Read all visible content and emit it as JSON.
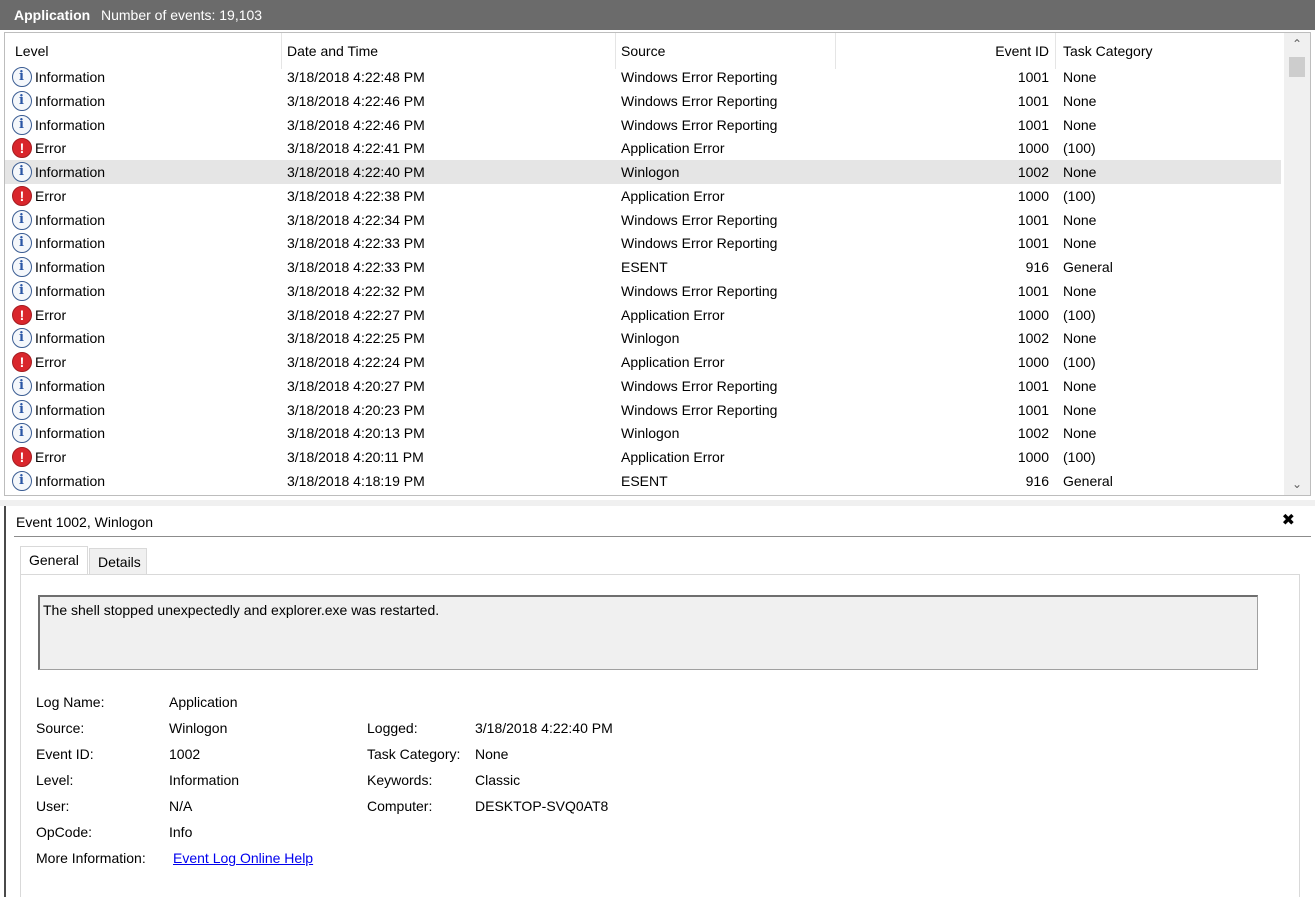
{
  "titlebar": {
    "log_name": "Application",
    "event_count": "Number of events: 19,103"
  },
  "grid": {
    "columns": [
      "Level",
      "Date and Time",
      "Source",
      "Event ID",
      "Task Category"
    ],
    "rows": [
      {
        "level": "Information",
        "icon": "info-icon",
        "date": "3/18/2018 4:22:48 PM",
        "source": "Windows Error Reporting",
        "event_id": "1001",
        "category": "None"
      },
      {
        "level": "Information",
        "icon": "info-icon",
        "date": "3/18/2018 4:22:46 PM",
        "source": "Windows Error Reporting",
        "event_id": "1001",
        "category": "None"
      },
      {
        "level": "Information",
        "icon": "info-icon",
        "date": "3/18/2018 4:22:46 PM",
        "source": "Windows Error Reporting",
        "event_id": "1001",
        "category": "None"
      },
      {
        "level": "Error",
        "icon": "error-icon",
        "date": "3/18/2018 4:22:41 PM",
        "source": "Application Error",
        "event_id": "1000",
        "category": "(100)"
      },
      {
        "level": "Information",
        "icon": "info-icon",
        "date": "3/18/2018 4:22:40 PM",
        "source": "Winlogon",
        "event_id": "1002",
        "category": "None",
        "selected": true
      },
      {
        "level": "Error",
        "icon": "error-icon",
        "date": "3/18/2018 4:22:38 PM",
        "source": "Application Error",
        "event_id": "1000",
        "category": "(100)"
      },
      {
        "level": "Information",
        "icon": "info-icon",
        "date": "3/18/2018 4:22:34 PM",
        "source": "Windows Error Reporting",
        "event_id": "1001",
        "category": "None"
      },
      {
        "level": "Information",
        "icon": "info-icon",
        "date": "3/18/2018 4:22:33 PM",
        "source": "Windows Error Reporting",
        "event_id": "1001",
        "category": "None"
      },
      {
        "level": "Information",
        "icon": "info-icon",
        "date": "3/18/2018 4:22:33 PM",
        "source": "ESENT",
        "event_id": "916",
        "category": "General"
      },
      {
        "level": "Information",
        "icon": "info-icon",
        "date": "3/18/2018 4:22:32 PM",
        "source": "Windows Error Reporting",
        "event_id": "1001",
        "category": "None"
      },
      {
        "level": "Error",
        "icon": "error-icon",
        "date": "3/18/2018 4:22:27 PM",
        "source": "Application Error",
        "event_id": "1000",
        "category": "(100)"
      },
      {
        "level": "Information",
        "icon": "info-icon",
        "date": "3/18/2018 4:22:25 PM",
        "source": "Winlogon",
        "event_id": "1002",
        "category": "None"
      },
      {
        "level": "Error",
        "icon": "error-icon",
        "date": "3/18/2018 4:22:24 PM",
        "source": "Application Error",
        "event_id": "1000",
        "category": "(100)"
      },
      {
        "level": "Information",
        "icon": "info-icon",
        "date": "3/18/2018 4:20:27 PM",
        "source": "Windows Error Reporting",
        "event_id": "1001",
        "category": "None"
      },
      {
        "level": "Information",
        "icon": "info-icon",
        "date": "3/18/2018 4:20:23 PM",
        "source": "Windows Error Reporting",
        "event_id": "1001",
        "category": "None"
      },
      {
        "level": "Information",
        "icon": "info-icon",
        "date": "3/18/2018 4:20:13 PM",
        "source": "Winlogon",
        "event_id": "1002",
        "category": "None"
      },
      {
        "level": "Error",
        "icon": "error-icon",
        "date": "3/18/2018 4:20:11 PM",
        "source": "Application Error",
        "event_id": "1000",
        "category": "(100)"
      },
      {
        "level": "Information",
        "icon": "info-icon",
        "date": "3/18/2018 4:18:19 PM",
        "source": "ESENT",
        "event_id": "916",
        "category": "General"
      }
    ]
  },
  "detail": {
    "title": "Event 1002, Winlogon",
    "close_icon": "close-icon",
    "tabs": [
      "General",
      "Details"
    ],
    "description": "The shell stopped unexpectedly and explorer.exe was restarted.",
    "fields": {
      "log_name_label": "Log Name:",
      "log_name": "Application",
      "source_label": "Source:",
      "source": "Winlogon",
      "event_id_label": "Event ID:",
      "event_id": "1002",
      "level_label": "Level:",
      "level": "Information",
      "user_label": "User:",
      "user": "N/A",
      "opcode_label": "OpCode:",
      "opcode": "Info",
      "more_info_label": "More Information:",
      "more_info_link": "Event Log Online Help",
      "logged_label": "Logged:",
      "logged": "3/18/2018 4:22:40 PM",
      "task_category_label": "Task Category:",
      "task_category": "None",
      "keywords_label": "Keywords:",
      "keywords": "Classic",
      "computer_label": "Computer:",
      "computer": "DESKTOP-SVQ0AT8"
    }
  },
  "colors": {
    "titlebar": "#6b6b6b",
    "selected_row": "#e5e5e5",
    "info_icon": "#2a56a5",
    "error_icon": "#d9262c",
    "link": "#0000ee"
  }
}
